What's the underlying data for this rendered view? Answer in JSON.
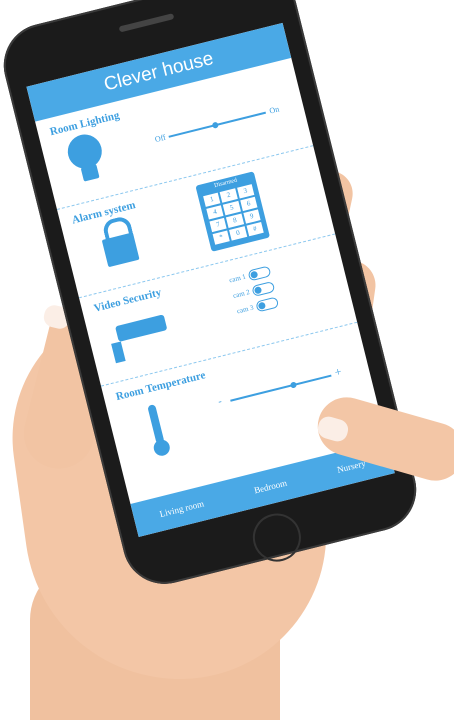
{
  "app": {
    "title": "Clever house"
  },
  "sections": {
    "lighting": {
      "title": "Room Lighting",
      "off_label": "Off",
      "on_label": "On",
      "level_fraction": 0.45
    },
    "alarm": {
      "title": "Alarm system",
      "keypad_title": "Disarmed",
      "keys": [
        "1",
        "2",
        "3",
        "4",
        "5",
        "6",
        "7",
        "8",
        "9",
        "*",
        "0",
        "#"
      ]
    },
    "video": {
      "title": "Video Security",
      "cams": [
        "cam 1",
        "cam 2",
        "cam 3"
      ]
    },
    "temperature": {
      "title": "Room Temperature",
      "minus_label": "-",
      "plus_label": "+",
      "level_fraction": 0.6
    }
  },
  "tabs": {
    "items": [
      "Living room",
      "Bedroom",
      "Nursery"
    ]
  },
  "colors": {
    "accent": "#4aa9e6"
  }
}
